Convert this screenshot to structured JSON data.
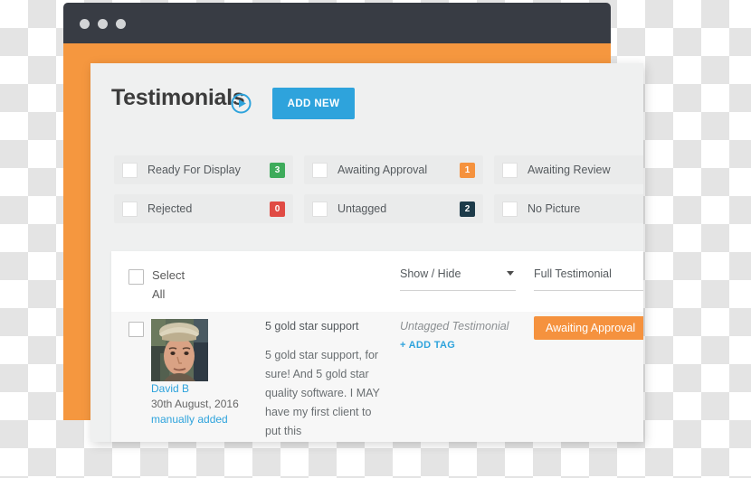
{
  "browser": {
    "dots": [
      "dot-1",
      "dot-2",
      "dot-3"
    ],
    "titlebar_color": "#383c44",
    "body_color": "#f5973f"
  },
  "header": {
    "title": "Testimonials",
    "play_icon": "play-circle-icon",
    "add_new_label": "ADD NEW",
    "accent_color": "#2ea3dc"
  },
  "filters": [
    {
      "label": "Ready For Display",
      "count": "3",
      "color": "#3eab5b",
      "checked": false
    },
    {
      "label": "Awaiting Approval",
      "count": "1",
      "color": "#f5923e",
      "checked": false
    },
    {
      "label": "Awaiting Review",
      "count": "",
      "color": "",
      "checked": false
    },
    {
      "label": "Rejected",
      "count": "0",
      "color": "#e04b44",
      "checked": false
    },
    {
      "label": "Untagged",
      "count": "2",
      "color": "#1d3b4a",
      "checked": false
    },
    {
      "label": "No Picture",
      "count": "",
      "color": "",
      "checked": false
    }
  ],
  "list": {
    "select_all_label": "Select All",
    "show_hide_label": "Show / Hide",
    "full_testimonial_label": "Full Testimonial",
    "rows": [
      {
        "author_name": "David B",
        "date": "30th August, 2016",
        "source": "manually added",
        "title": "5 gold star support",
        "body": "5 gold star support, for sure! And 5 gold star quality software. I MAY have my first client to put this",
        "tag": "Untagged Testimonial",
        "add_tag_label": "+ ADD TAG",
        "status": "Awaiting Approval",
        "status_color": "#f5923e"
      }
    ]
  }
}
